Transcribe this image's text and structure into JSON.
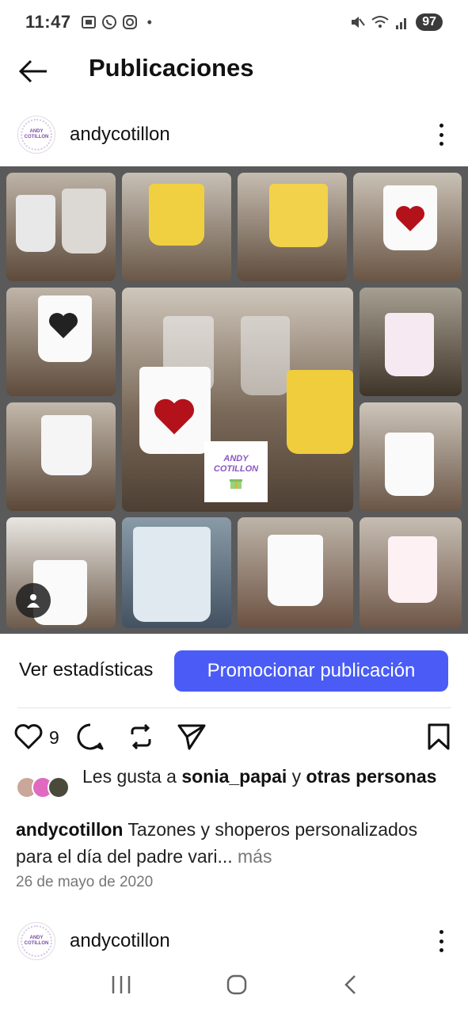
{
  "status_bar": {
    "time": "11:47",
    "dot": "•",
    "battery": "97",
    "icons": [
      "screenshot-icon",
      "whatsapp-icon",
      "instagram-icon",
      "mute-icon",
      "wifi-icon",
      "signal-icon"
    ]
  },
  "header": {
    "title": "Publicaciones"
  },
  "post": {
    "username": "andycotillon",
    "avatar_text": "ANDY COTILLON",
    "image": {
      "logo_line1": "ANDY",
      "logo_line2": "COTILLON"
    },
    "stats_label": "Ver estadísticas",
    "promote_label": "Promocionar publicación",
    "like_count": "9",
    "likes": {
      "prefix": "Les gusta a ",
      "user": "sonia_papai",
      "connector": " y ",
      "others": "otras personas"
    },
    "caption": {
      "user": "andycotillon",
      "text": " Tazones y shoperos personalizados para el día del padre vari...",
      "more": " más"
    },
    "date": "26 de mayo de 2020"
  },
  "next_post": {
    "username": "andycotillon"
  },
  "colors": {
    "promote_bg": "#4a5cf5",
    "text": "#111111",
    "muted": "#777777"
  }
}
